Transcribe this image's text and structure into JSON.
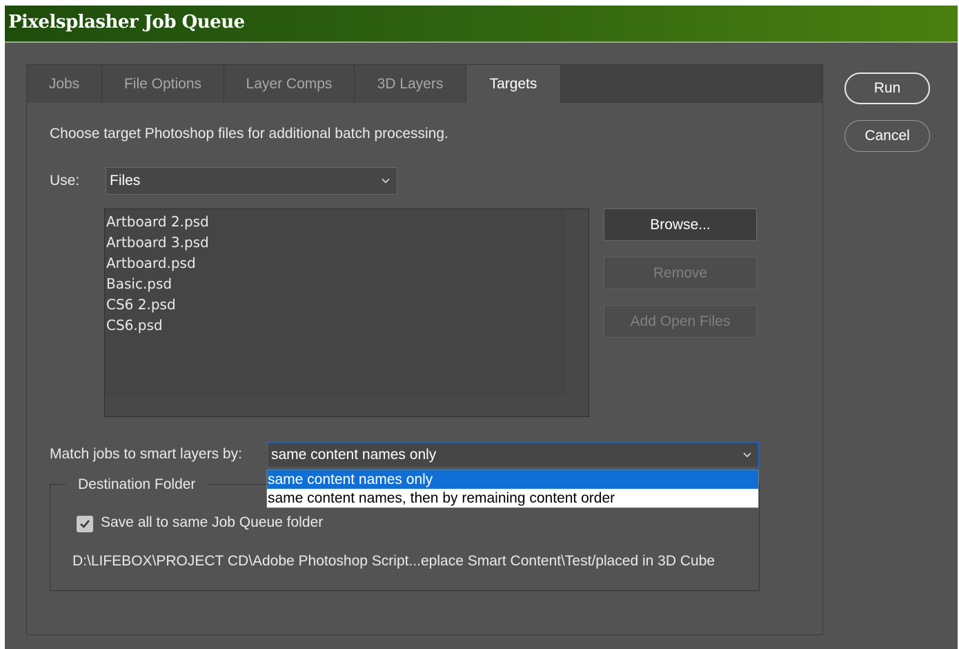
{
  "window": {
    "title": "Pixelsplasher Job Queue"
  },
  "tabs": [
    {
      "label": "Jobs",
      "active": false
    },
    {
      "label": "File Options",
      "active": false
    },
    {
      "label": "Layer Comps",
      "active": false
    },
    {
      "label": "3D Layers",
      "active": false
    },
    {
      "label": "Targets",
      "active": true
    }
  ],
  "targets": {
    "description": "Choose target Photoshop files for additional batch processing.",
    "use_label": "Use:",
    "use_value": "Files",
    "files": [
      "Artboard 2.psd",
      "Artboard 3.psd",
      "Artboard.psd",
      "Basic.psd",
      "CS6 2.psd",
      "CS6.psd"
    ],
    "browse_label": "Browse...",
    "remove_label": "Remove",
    "add_open_files_label": "Add Open Files",
    "match_label": "Match jobs to smart layers by:",
    "match_value": "same content names only",
    "match_options": [
      "same content names only",
      "same content names, then by remaining content order"
    ],
    "match_selected_index": 0
  },
  "destination": {
    "legend": "Destination Folder",
    "save_same_label": "Save all to same Job Queue folder",
    "save_same_checked": true,
    "path": "D:\\LIFEBOX\\PROJECT CD\\Adobe Photoshop Script...eplace Smart Content\\Test/placed in 3D Cube"
  },
  "actions": {
    "run_label": "Run",
    "cancel_label": "Cancel"
  },
  "colors": {
    "panel_bg": "#535353",
    "titlebar_left": "#1e4d0c",
    "titlebar_right": "#4a8010",
    "selection_blue": "#0f6fd6"
  }
}
